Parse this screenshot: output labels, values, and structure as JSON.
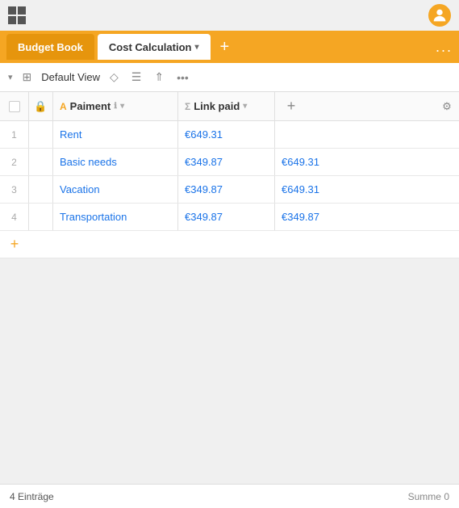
{
  "titlebar": {
    "windows_icon": "⊞"
  },
  "tabs": {
    "budget_book": "Budget Book",
    "cost_calc": "Cost Calculation",
    "add_tab": "+",
    "more": "..."
  },
  "toolbar": {
    "chevron": "▾",
    "view_label": "Default View",
    "icon_diamond": "◇",
    "icon_list": "☰",
    "icon_share": "⇑",
    "icon_more": "..."
  },
  "table": {
    "headers": {
      "paiment": "Paiment",
      "link_paid": "Link paid",
      "add": "+",
      "settings": "⚙"
    },
    "rows": [
      {
        "num": "1",
        "name": "Rent",
        "paiment": "€649.31",
        "linkpaid": ""
      },
      {
        "num": "2",
        "name": "Basic needs",
        "paiment": "€349.87",
        "linkpaid": "€649.31"
      },
      {
        "num": "3",
        "name": "Vacation",
        "paiment": "€349.87",
        "linkpaid": "€649.31"
      },
      {
        "num": "4",
        "name": "Transportation",
        "paiment": "€349.87",
        "linkpaid": "€349.87"
      }
    ]
  },
  "statusbar": {
    "entries": "4 Einträge",
    "sum_label": "Summe",
    "sum_value": "0"
  }
}
